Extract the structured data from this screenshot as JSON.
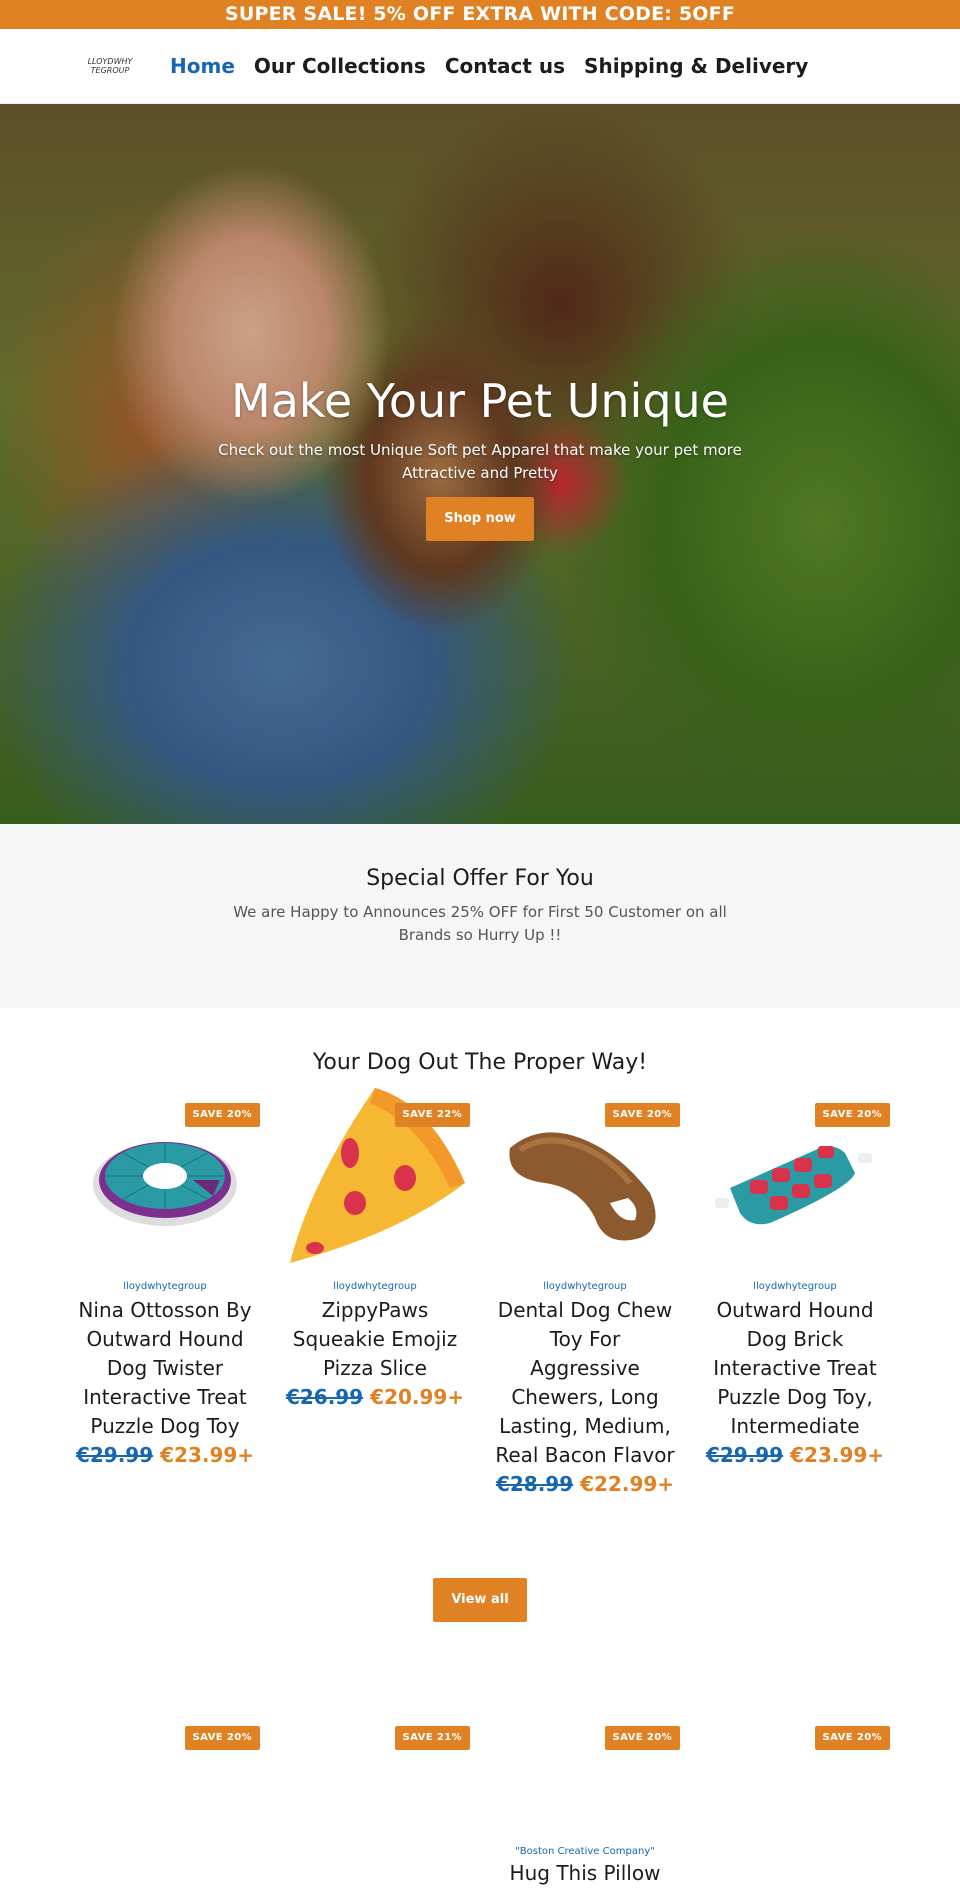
{
  "announcement": "SUPER SALE! 5% OFF EXTRA WITH CODE: 5OFF",
  "header": {
    "logo_line1": "LLOYDWHY",
    "logo_line2": "TEGROUP",
    "nav": [
      {
        "label": "Home",
        "active": true
      },
      {
        "label": "Our Collections",
        "active": false
      },
      {
        "label": "Contact us",
        "active": false
      },
      {
        "label": "Shipping & Delivery",
        "active": false
      }
    ]
  },
  "hero": {
    "title": "Make Your Pet Unique",
    "subtitle": "Check out the most Unique Soft pet Apparel that make your pet more Attractive and Pretty",
    "button": "Shop now"
  },
  "offer": {
    "title": "Special Offer For You",
    "text": "We are Happy to Announces 25% OFF for First 50 Customer on all Brands so Hurry Up !!"
  },
  "collection": {
    "title": "Your Dog Out The Proper Way!",
    "products": [
      {
        "badge": "SAVE 20%",
        "vendor": "lloydwhytegroup",
        "title": "Nina Ottosson By Outward Hound Dog Twister Interactive Treat Puzzle Dog Toy",
        "old_price": "€29.99",
        "price": "€23.99+",
        "image": "dog-twister-puzzle"
      },
      {
        "badge": "SAVE 22%",
        "vendor": "lloydwhytegroup",
        "title": "ZippyPaws Squeakie Emojiz Pizza Slice",
        "old_price": "€26.99",
        "price": "€20.99+",
        "image": "pizza-slice-toy"
      },
      {
        "badge": "SAVE 20%",
        "vendor": "lloydwhytegroup",
        "title": "Dental Dog Chew Toy For Aggressive Chewers, Long Lasting, Medium, Real Bacon Flavor",
        "old_price": "€28.99",
        "price": "€22.99+",
        "image": "dental-chew-toy"
      },
      {
        "badge": "SAVE 20%",
        "vendor": "lloydwhytegroup",
        "title": "Outward Hound Dog Brick Interactive Treat Puzzle Dog Toy, Intermediate",
        "old_price": "€29.99",
        "price": "€23.99+",
        "image": "dog-brick-puzzle"
      }
    ],
    "view_all": "View all"
  },
  "collection2": {
    "products": [
      {
        "badge": "SAVE 20%"
      },
      {
        "badge": "SAVE 21%"
      },
      {
        "badge": "SAVE 20%",
        "vendor": "\"Boston Creative Company\"",
        "title": "Hug This Pillow"
      },
      {
        "badge": "SAVE 20%"
      }
    ]
  }
}
